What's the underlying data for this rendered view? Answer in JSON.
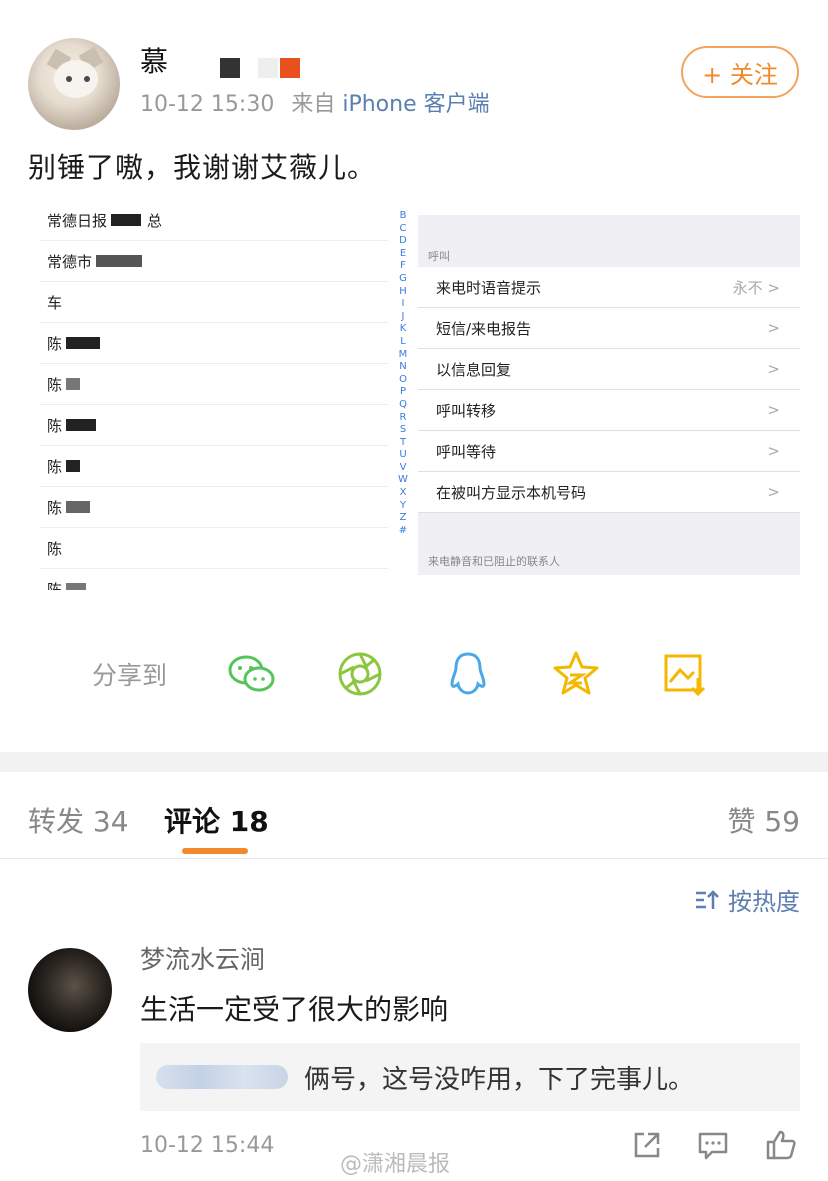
{
  "post": {
    "username": "慕",
    "time": "10-12 15:30",
    "source_prefix": "来自",
    "source": "iPhone 客户端",
    "follow_label": "+ 关注",
    "text": "别锤了嗷，我谢谢艾薇儿。"
  },
  "screenshot": {
    "contacts": [
      "常德日报",
      "常德市",
      "车",
      "陈",
      "陈",
      "陈",
      "陈",
      "陈",
      "陈",
      "陈"
    ],
    "alphabet": [
      "B",
      "C",
      "D",
      "E",
      "F",
      "G",
      "H",
      "I",
      "J",
      "K",
      "L",
      "M",
      "N",
      "O",
      "P",
      "Q",
      "R",
      "S",
      "T",
      "U",
      "V",
      "W",
      "X",
      "Y",
      "Z",
      "#"
    ],
    "section1": "呼叫",
    "rows": [
      {
        "label": "来电时语音提示",
        "right": "永不 >"
      },
      {
        "label": "短信/来电报告",
        "right": ">"
      },
      {
        "label": "以信息回复",
        "right": ">"
      },
      {
        "label": "呼叫转移",
        "right": ">"
      },
      {
        "label": "呼叫等待",
        "right": ">"
      },
      {
        "label": "在被叫方显示本机号码",
        "right": ">"
      }
    ],
    "section2": "来电静音和已阻止的联系人"
  },
  "share": {
    "label": "分享到",
    "icons": [
      "wechat-icon",
      "moments-icon",
      "qq-icon",
      "qzone-icon",
      "save-image-icon"
    ]
  },
  "tabs": {
    "repost": "转发 34",
    "comment": "评论 18",
    "like": "赞 59"
  },
  "sort_label": "按热度",
  "comment": {
    "name": "梦流水云涧",
    "text": "生活一定受了很大的影响",
    "reply": "俩号，这号没咋用，下了完事儿。",
    "time": "10-12 15:44"
  },
  "watermark": "@潇湘晨报",
  "colors": {
    "accent": "#f08a2c",
    "link": "#5b7fb0",
    "share_green": "#56c45a",
    "share_yellow": "#f5b800",
    "share_blue": "#4aa8e8"
  }
}
